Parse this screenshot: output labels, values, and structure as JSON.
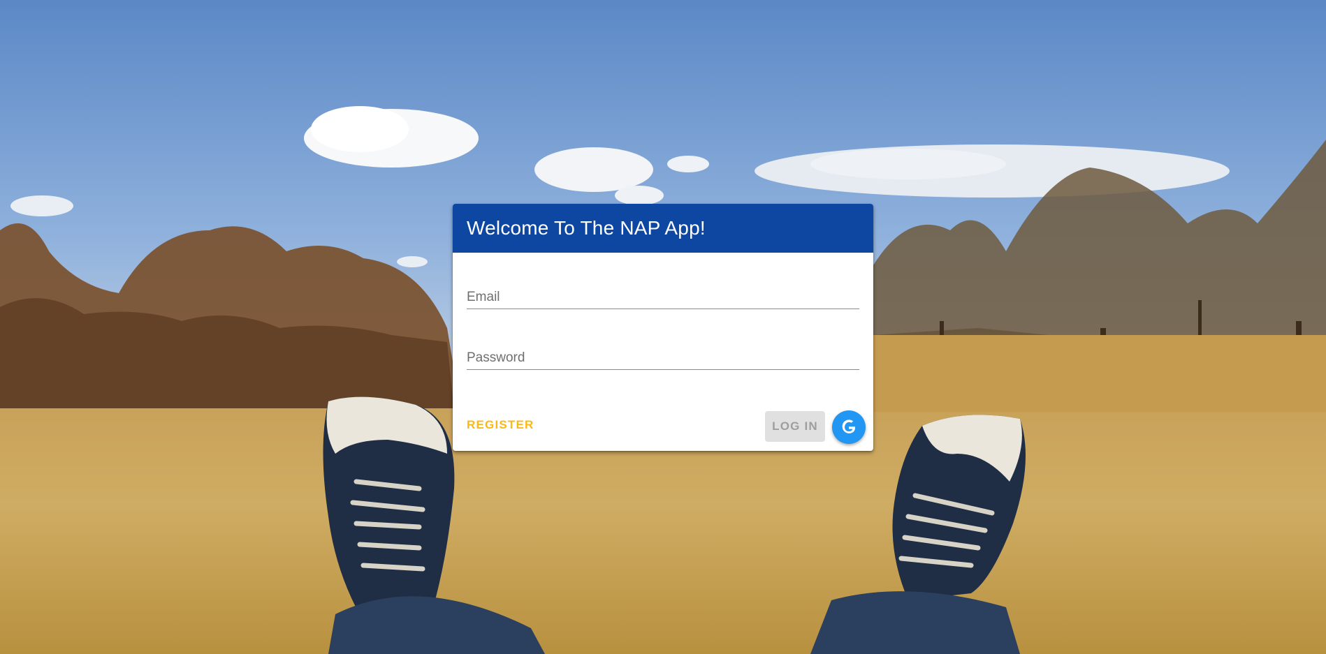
{
  "login": {
    "title": "Welcome To The NAP App!",
    "email_placeholder": "Email",
    "password_placeholder": "Password",
    "register_label": "REGISTER",
    "login_label": "LOG IN"
  },
  "colors": {
    "header": "#0d47a1",
    "register": "#fbb917",
    "google_button": "#2196f3",
    "login_disabled_bg": "#e0e0e0",
    "login_disabled_text": "#9e9e9e"
  },
  "icons": {
    "social_login": "google-g-icon"
  }
}
